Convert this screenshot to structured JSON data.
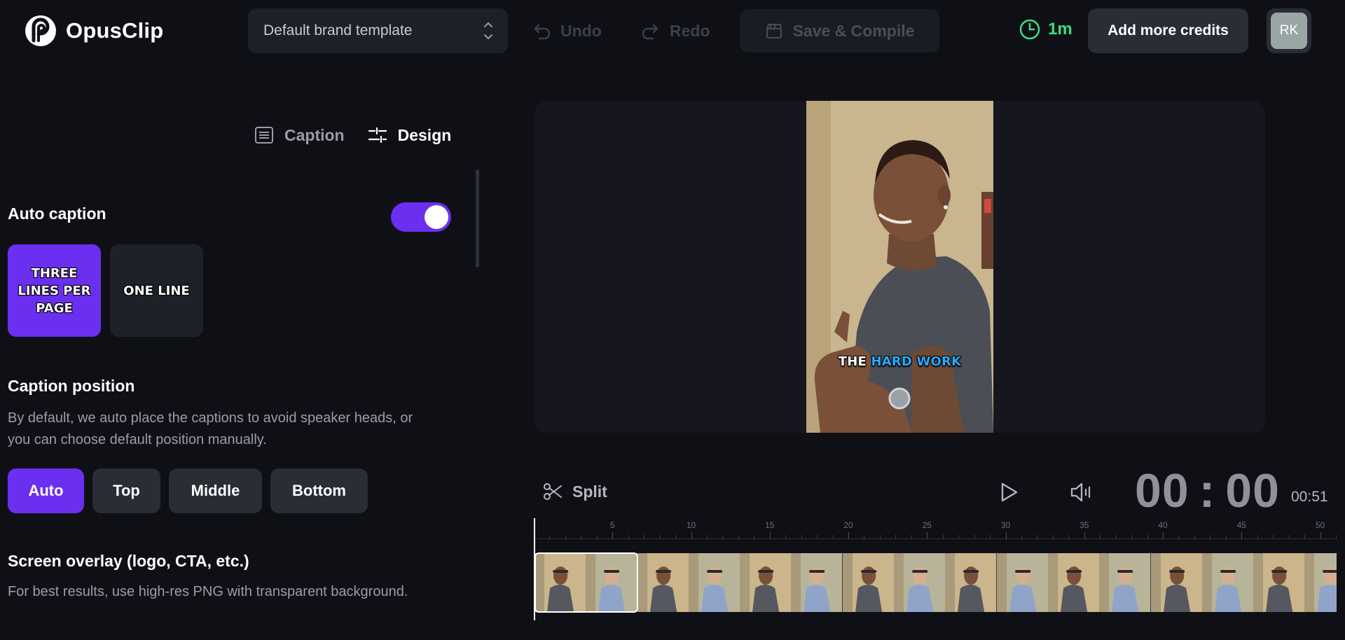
{
  "app": {
    "name": "OpusClip",
    "template_select": {
      "value": "Default brand template"
    },
    "toolbar": {
      "undo_label": "Undo",
      "redo_label": "Redo",
      "compile_label": "Save & Compile"
    },
    "credit_time": "1m",
    "add_credits_label": "Add more credits",
    "avatar_initials": "RK"
  },
  "panel": {
    "tabs": [
      {
        "label": "Caption",
        "icon": "list-icon",
        "active": false
      },
      {
        "label": "Design",
        "icon": "sliders-icon",
        "active": true
      }
    ],
    "auto_caption": {
      "title": "Auto caption",
      "enabled": true
    },
    "caption_styles": [
      {
        "label": "THREE LINES PER PAGE",
        "selected": true
      },
      {
        "label": "ONE LINE",
        "selected": false
      }
    ],
    "caption_position": {
      "title": "Caption position",
      "description": "By default, we auto place the captions to avoid speaker heads, or you can choose default position manually.",
      "options": [
        "Auto",
        "Top",
        "Middle",
        "Bottom"
      ],
      "selected": "Auto"
    },
    "screen_overlay": {
      "title": "Screen overlay (logo, CTA, etc.)",
      "description": "For best results, use high-res PNG with transparent background."
    }
  },
  "preview": {
    "caption_words": [
      "THE",
      "HARD WORK"
    ],
    "highlight_color": "#2aa9ff"
  },
  "player": {
    "split_label": "Split",
    "timer_minutes": "00",
    "timer_seconds": "00",
    "duration": "00:51"
  },
  "timeline": {
    "ruler_labels": [
      "5",
      "10",
      "15",
      "20",
      "25",
      "30",
      "35",
      "40",
      "45",
      "50"
    ],
    "clip_length_seconds": 51
  },
  "colors": {
    "accent": "#6b2ff0",
    "success": "#3ddc84",
    "background": "#0f1016"
  }
}
